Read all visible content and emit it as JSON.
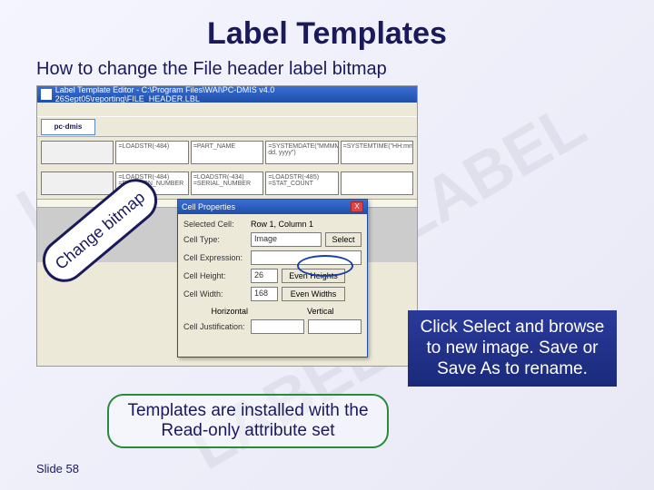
{
  "slide": {
    "title": "Label Templates",
    "subtitle": "How to change the File header label bitmap",
    "number": "Slide 58"
  },
  "editor": {
    "window_title": "Label Template Editor - C:\\Program Files\\WAI\\PC-DMIS v4.0 26Sept05\\reporting\\FILE_HEADER.LBL",
    "logo_text": "pc·dmis",
    "fields_row1": [
      "",
      "=LOADSTR(-484)",
      "=PART_NAME",
      "=SYSTEMDATE(\"MMMM dd, yyyy\")",
      "=SYSTEMTIME(\"HH:mm\")"
    ],
    "fields_row2": [
      "",
      "=LOADSTR(-484) =REVISION_NUMBER",
      "=LOADSTR(-434) =SERIAL_NUMBER",
      "=LOADSTR(-485) =STAT_COUNT",
      ""
    ]
  },
  "dialog": {
    "title": "Cell Properties",
    "close": "X",
    "selected_cell_label": "Selected Cell:",
    "selected_cell_value": "Row 1, Column 1",
    "cell_type_label": "Cell Type:",
    "cell_type_value": "Image",
    "select_btn": "Select",
    "cell_expr_label": "Cell Expression:",
    "cell_expr_value": "",
    "cell_height_label": "Cell Height:",
    "cell_height_value": "26",
    "even_heights": "Even Heights",
    "cell_width_label": "Cell Width:",
    "cell_width_value": "168",
    "even_widths": "Even Widths",
    "justify_label": "Cell Justification:",
    "horizontal": "Horizontal",
    "vertical": "Vertical"
  },
  "callouts": {
    "tilt": "Change bitmap",
    "blue": "Click Select and browse to new image. Save or Save As to rename.",
    "green": "Templates are installed with the Read-only attribute set"
  }
}
